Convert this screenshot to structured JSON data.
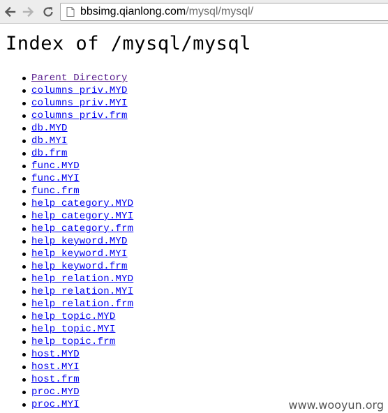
{
  "browser": {
    "url_host": "bbsimg.qianlong.com",
    "url_path": "/mysql/mysql/"
  },
  "page": {
    "title": "Index of /mysql/mysql",
    "entries": [
      {
        "label": "Parent Directory",
        "visited": true
      },
      {
        "label": "columns_priv.MYD",
        "visited": false
      },
      {
        "label": "columns_priv.MYI",
        "visited": false
      },
      {
        "label": "columns_priv.frm",
        "visited": false
      },
      {
        "label": "db.MYD",
        "visited": false
      },
      {
        "label": "db.MYI",
        "visited": false
      },
      {
        "label": "db.frm",
        "visited": false
      },
      {
        "label": "func.MYD",
        "visited": false
      },
      {
        "label": "func.MYI",
        "visited": false
      },
      {
        "label": "func.frm",
        "visited": false
      },
      {
        "label": "help_category.MYD",
        "visited": false
      },
      {
        "label": "help_category.MYI",
        "visited": false
      },
      {
        "label": "help_category.frm",
        "visited": false
      },
      {
        "label": "help_keyword.MYD",
        "visited": false
      },
      {
        "label": "help_keyword.MYI",
        "visited": false
      },
      {
        "label": "help_keyword.frm",
        "visited": false
      },
      {
        "label": "help_relation.MYD",
        "visited": false
      },
      {
        "label": "help_relation.MYI",
        "visited": false
      },
      {
        "label": "help_relation.frm",
        "visited": false
      },
      {
        "label": "help_topic.MYD",
        "visited": false
      },
      {
        "label": "help_topic.MYI",
        "visited": false
      },
      {
        "label": "help_topic.frm",
        "visited": false
      },
      {
        "label": "host.MYD",
        "visited": false
      },
      {
        "label": "host.MYI",
        "visited": false
      },
      {
        "label": "host.frm",
        "visited": false
      },
      {
        "label": "proc.MYD",
        "visited": false
      },
      {
        "label": "proc.MYI",
        "visited": false
      }
    ]
  },
  "watermark": "www.wooyun.org",
  "icons": {
    "back": "back-arrow-icon",
    "forward": "forward-arrow-icon",
    "reload": "reload-icon",
    "page": "page-icon"
  },
  "colors": {
    "link": "#0000ee",
    "visited_link": "#551a8b"
  }
}
